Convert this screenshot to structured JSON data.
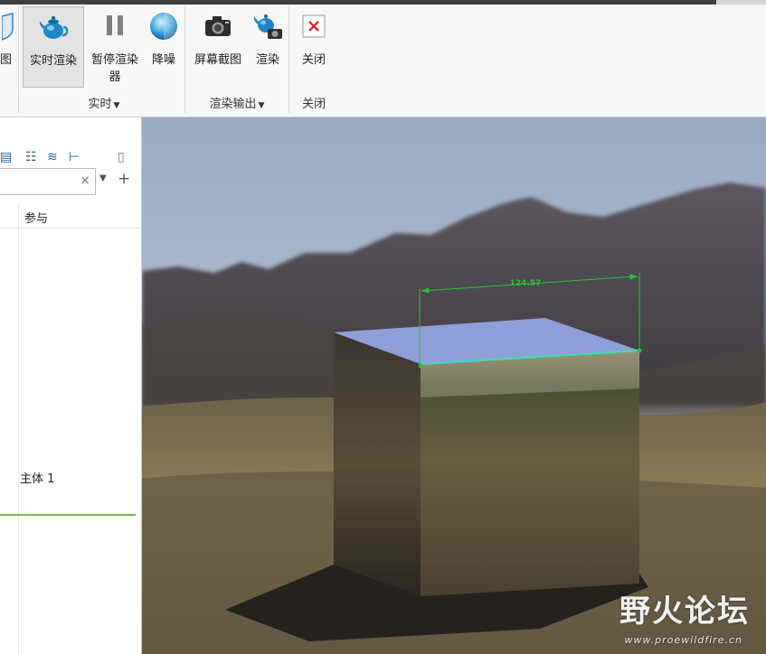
{
  "ribbon": {
    "prev_tail_label": "图",
    "buttons": [
      {
        "label": "实时渲染",
        "icon": "teapot-render-icon",
        "active": true
      },
      {
        "label": "暂停渲染器",
        "icon": "pause-icon"
      },
      {
        "label": "降噪",
        "icon": "denoise-sphere-icon"
      },
      {
        "label": "屏幕截图",
        "icon": "camera-icon"
      },
      {
        "label": "渲染",
        "icon": "teapot-camera-icon"
      },
      {
        "label": "关闭",
        "icon": "close-x-icon"
      }
    ],
    "groups": [
      {
        "label": "实时",
        "dropdown": true
      },
      {
        "label": "渲染输出",
        "dropdown": true
      },
      {
        "label": "关闭",
        "dropdown": false
      }
    ]
  },
  "panel": {
    "search_value": "",
    "column_header": "参与",
    "body_row": "主体 1"
  },
  "viewport": {
    "dimension": "124.57",
    "watermark_cn": "野火论坛",
    "watermark_url": "www.proewildfire.cn"
  },
  "colors": {
    "accent_green": "#6cc04a",
    "dimension_green": "#2bbf3a",
    "close_red": "#d9262c",
    "icon_blue": "#1d86c8",
    "top_face": "#8e9fd8"
  }
}
